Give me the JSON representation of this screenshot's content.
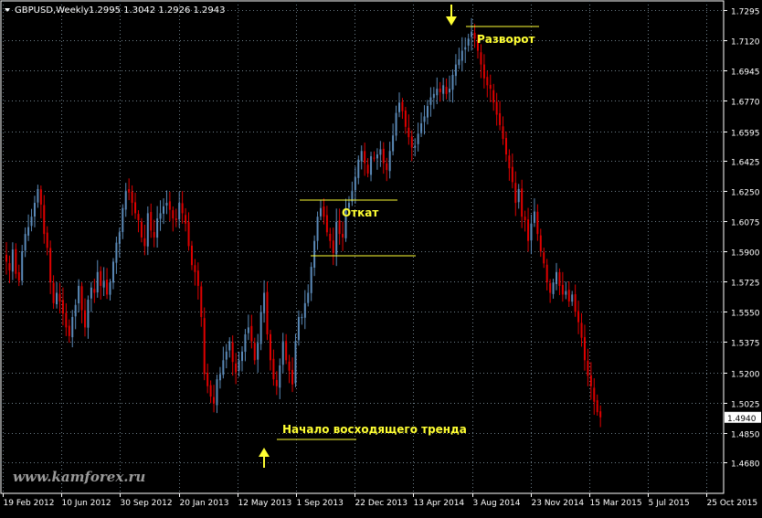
{
  "header": {
    "symbol_label": "GBPUSD,Weekly",
    "ohlc_text": "1.2995 1.3042 1.2926 1.2943",
    "menu_icon": "triangle-down-icon"
  },
  "watermark": "www.kamforex.ru",
  "annotations": {
    "reversal": "Разворот",
    "pullback": "Откат",
    "uptrend_start": "Начало восходящего тренда"
  },
  "colors": {
    "background": "#000000",
    "grid": "#6e7f8a",
    "bull": "#5b8ab8",
    "bear": "#e00000",
    "annotation": "#ffff33",
    "axis_text": "#ffffff",
    "watermark": "#9a9a9a"
  },
  "chart_data": {
    "type": "candlestick",
    "x_ticks": [
      "19 Feb 2012",
      "10 Jun 2012",
      "30 Sep 2012",
      "20 Jan 2013",
      "12 May 2013",
      "1 Sep 2013",
      "22 Dec 2013",
      "13 Apr 2014",
      "3 Aug 2014",
      "23 Nov 2014",
      "15 Mar 2015",
      "5 Jul 2015",
      "25 Oct 2015"
    ],
    "y_ticks": [
      1.7295,
      1.712,
      1.6945,
      1.677,
      1.6595,
      1.6425,
      1.625,
      1.6075,
      1.59,
      1.5725,
      1.555,
      1.5375,
      1.52,
      1.5025,
      1.485,
      1.468
    ],
    "ylim": [
      1.458,
      1.735
    ],
    "grid": true,
    "weekly_close": [
      1.584,
      1.579,
      1.591,
      1.577,
      1.573,
      1.59,
      1.6,
      1.604,
      1.61,
      1.618,
      1.626,
      1.617,
      1.6,
      1.592,
      1.572,
      1.56,
      1.566,
      1.561,
      1.554,
      1.546,
      1.541,
      1.552,
      1.559,
      1.57,
      1.556,
      1.546,
      1.562,
      1.569,
      1.566,
      1.578,
      1.57,
      1.573,
      1.565,
      1.572,
      1.584,
      1.595,
      1.601,
      1.615,
      1.625,
      1.624,
      1.618,
      1.612,
      1.608,
      1.598,
      1.593,
      1.612,
      1.602,
      1.598,
      1.609,
      1.612,
      1.616,
      1.618,
      1.614,
      1.609,
      1.608,
      1.618,
      1.612,
      1.606,
      1.593,
      1.582,
      1.578,
      1.57,
      1.552,
      1.519,
      1.512,
      1.506,
      1.502,
      1.516,
      1.519,
      1.527,
      1.532,
      1.538,
      1.526,
      1.52,
      1.527,
      1.532,
      1.542,
      1.546,
      1.538,
      1.527,
      1.537,
      1.555,
      1.566,
      1.542,
      1.527,
      1.516,
      1.512,
      1.524,
      1.538,
      1.527,
      1.521,
      1.513,
      1.538,
      1.552,
      1.552,
      1.56,
      1.566,
      1.581,
      1.596,
      1.61,
      1.615,
      1.61,
      1.601,
      1.596,
      1.589,
      1.607,
      1.6,
      1.598,
      1.615,
      1.618,
      1.625,
      1.633,
      1.643,
      1.648,
      1.641,
      1.635,
      1.645,
      1.644,
      1.646,
      1.649,
      1.641,
      1.637,
      1.648,
      1.657,
      1.67,
      1.676,
      1.671,
      1.662,
      1.656,
      1.65,
      1.651,
      1.658,
      1.664,
      1.668,
      1.674,
      1.679,
      1.681,
      1.684,
      1.682,
      1.686,
      1.681,
      1.684,
      1.692,
      1.698,
      1.701,
      1.706,
      1.708,
      1.713,
      1.717,
      1.713,
      1.706,
      1.698,
      1.69,
      1.686,
      1.684,
      1.676,
      1.669,
      1.663,
      1.655,
      1.646,
      1.638,
      1.63,
      1.618,
      1.626,
      1.61,
      1.608,
      1.596,
      1.606,
      1.613,
      1.6,
      1.59,
      1.583,
      1.572,
      1.566,
      1.572,
      1.578,
      1.57,
      1.565,
      1.567,
      1.561,
      1.565,
      1.555,
      1.549,
      1.54,
      1.527,
      1.518,
      1.512,
      1.503,
      1.497,
      1.494
    ]
  }
}
